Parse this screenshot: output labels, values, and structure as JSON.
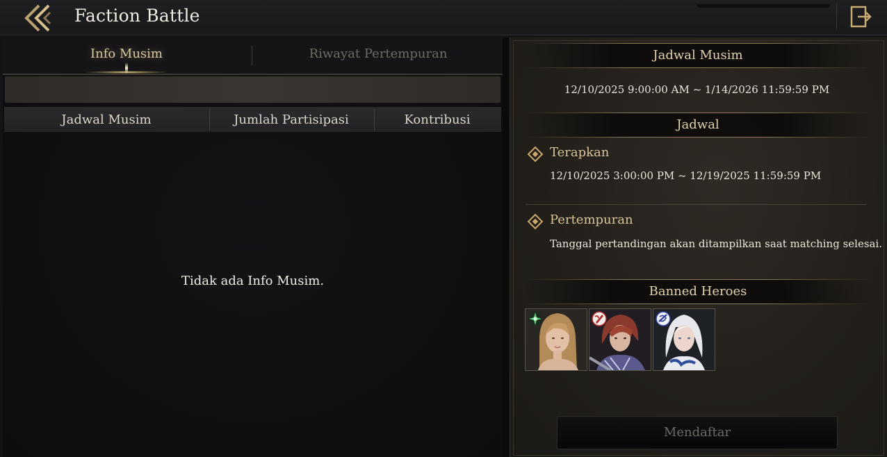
{
  "header": {
    "title": "Faction Battle"
  },
  "tabs": [
    {
      "label": "Info Musim",
      "active": true
    },
    {
      "label": "Riwayat Pertempuran",
      "active": false
    }
  ],
  "table": {
    "columns": [
      "Jadwal Musim",
      "Jumlah Partisipasi",
      "Kontribusi"
    ],
    "rows": [],
    "empty_message": "Tidak ada Info Musim."
  },
  "season_schedule": {
    "heading": "Jadwal Musim",
    "period": "12/10/2025 9:00:00 AM ~ 1/14/2026 11:59:59 PM"
  },
  "schedule": {
    "heading": "Jadwal",
    "items": [
      {
        "title": "Terapkan",
        "text": "12/10/2025 3:00:00 PM ~ 12/19/2025 11:59:59 PM"
      },
      {
        "title": "Pertempuran",
        "text": "Tanggal pertandingan akan ditampilkan saat matching selesai."
      }
    ]
  },
  "banned_heroes": {
    "heading": "Banned Heroes",
    "heroes": [
      {
        "portrait": "blonde-woman-portrait",
        "class_icon": "green-leaf-class-icon"
      },
      {
        "portrait": "red-haired-man-portrait",
        "class_icon": "red-warrior-class-icon"
      },
      {
        "portrait": "white-haired-woman-portrait",
        "class_icon": "blue-mage-class-icon"
      }
    ]
  },
  "register_button": {
    "label": "Mendaftar",
    "enabled": false
  },
  "colors": {
    "accent_gold": "#c9a86a",
    "heading_gold": "#e3d3ad",
    "background": "#141416"
  }
}
